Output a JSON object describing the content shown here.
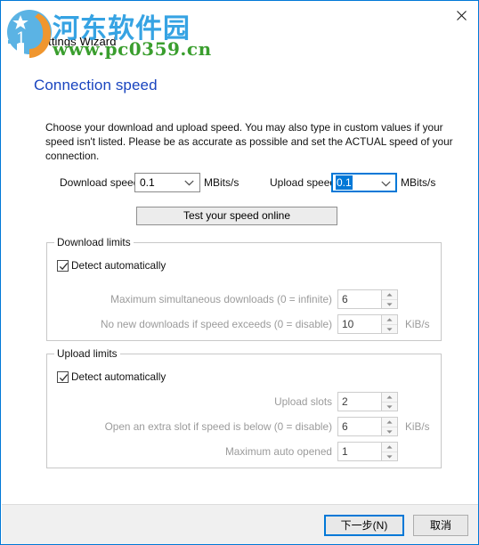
{
  "window": {
    "wizard_title": "Settings Wizard",
    "close_icon": "close-icon",
    "accent_color": "#0078d7"
  },
  "page": {
    "title": "Connection speed",
    "title_color": "#1a45bf",
    "description": "Choose your download and upload speed. You may also type in custom values if your speed isn't listed. Please be as accurate as possible and set the ACTUAL speed of your connection."
  },
  "speed": {
    "download_label": "Download speed",
    "download_value": "0.1",
    "download_unit": "MBits/s",
    "upload_label": "Upload speed",
    "upload_value": "0.1",
    "upload_unit": "MBits/s",
    "dropdown_icon": "chevron-down-icon",
    "test_button": "Test your speed online"
  },
  "download_limits": {
    "legend": "Download limits",
    "detect_label": "Detect automatically",
    "detect_checked": true,
    "rows": [
      {
        "label": "Maximum simultaneous downloads (0 = infinite)",
        "value": "6",
        "unit": ""
      },
      {
        "label": "No new downloads if speed exceeds (0 = disable)",
        "value": "10",
        "unit": "KiB/s"
      }
    ]
  },
  "upload_limits": {
    "legend": "Upload limits",
    "detect_label": "Detect automatically",
    "detect_checked": true,
    "rows": [
      {
        "label": "Upload slots",
        "value": "2",
        "unit": ""
      },
      {
        "label": "Open an extra slot if speed is below (0 = disable)",
        "value": "6",
        "unit": "KiB/s"
      },
      {
        "label": "Maximum auto opened",
        "value": "1",
        "unit": ""
      }
    ]
  },
  "footer": {
    "next_label": "下一步(N)",
    "cancel_label": "取消"
  },
  "watermark": {
    "site_name": "河东软件园",
    "site_url": "www.pc0359.cn",
    "site_name_color": "#36a3e3",
    "site_url_color": "#3a9e2e"
  }
}
